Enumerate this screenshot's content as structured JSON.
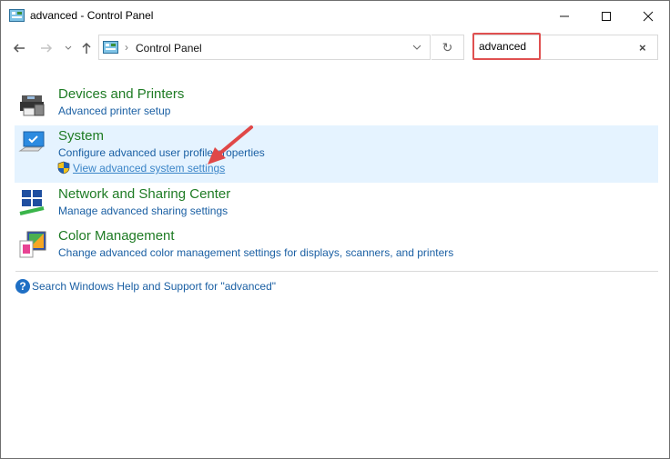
{
  "window": {
    "title": "advanced - Control Panel",
    "icon": "control-panel-icon",
    "buttons": {
      "minimize": "minimize-icon",
      "maximize": "maximize-icon",
      "close": "close-icon"
    }
  },
  "navigation": {
    "back": "back-arrow-icon",
    "forward": "forward-arrow-icon",
    "recent": "chevron-down-icon",
    "up": "up-arrow-icon",
    "address": {
      "separator": "›",
      "path": "Control Panel"
    },
    "refresh": "↻"
  },
  "search": {
    "value": "advanced",
    "clear": "×"
  },
  "results": [
    {
      "title": "Devices and Printers",
      "icon": "devices-printers-icon",
      "links": [
        "Advanced printer setup"
      ]
    },
    {
      "title": "System",
      "icon": "system-monitor-icon",
      "selected": true,
      "links": [
        "Configure advanced user profile properties"
      ],
      "shield_link": "View advanced system settings"
    },
    {
      "title": "Network and Sharing Center",
      "icon": "network-icon",
      "links": [
        "Manage advanced sharing settings"
      ]
    },
    {
      "title": "Color Management",
      "icon": "color-management-icon",
      "links": [
        "Change advanced color management settings for displays, scanners, and printers"
      ]
    }
  ],
  "help": {
    "icon": "?",
    "text": "Search Windows Help and Support for \"advanced\""
  },
  "colors": {
    "title_green": "#1e7b24",
    "link_blue": "#1a5fa3",
    "selection": "#e5f3ff",
    "annotation_red": "#e05050"
  }
}
